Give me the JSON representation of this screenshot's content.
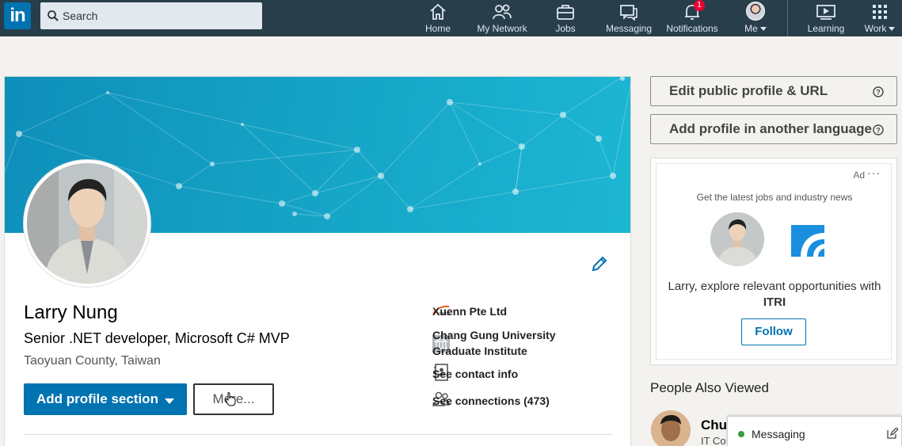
{
  "nav": {
    "logo": "in",
    "search_placeholder": "Search",
    "items": [
      {
        "label": "Home"
      },
      {
        "label": "My Network"
      },
      {
        "label": "Jobs"
      },
      {
        "label": "Messaging"
      },
      {
        "label": "Notifications",
        "badge": "1"
      },
      {
        "label": "Me"
      },
      {
        "label": "Learning"
      },
      {
        "label": "Work"
      }
    ]
  },
  "profile": {
    "name": "Larry Nung",
    "headline": "Senior .NET developer, Microsoft C# MVP",
    "location": "Taoyuan County, Taiwan",
    "add_section_label": "Add profile section",
    "more_label": "More...",
    "side": {
      "company": "Xuenn Pte Ltd",
      "school_line1": "Chang Gung University",
      "school_line2": "Graduate Institute",
      "contact": "See contact info",
      "connections": "See connections (473)"
    }
  },
  "right": {
    "edit_profile_url": "Edit public profile & URL",
    "add_language": "Add profile in another language",
    "ad": {
      "label": "Ad",
      "dots": "···",
      "tagline": "Get the latest jobs and industry news",
      "message_line1": "Larry, explore relevant opportunities with",
      "message_line2": "ITRI",
      "follow_label": "Follow"
    },
    "people_also_viewed": "People Also Viewed",
    "pav_first": {
      "name": "Chu",
      "subtitle": "IT Co"
    }
  },
  "messaging": {
    "label": "Messaging"
  },
  "colors": {
    "brand": "#0073b1",
    "nav_bg": "#283e4a",
    "banner": "#16a6c7",
    "online": "#3a9c3a",
    "badge": "#ee0033"
  }
}
